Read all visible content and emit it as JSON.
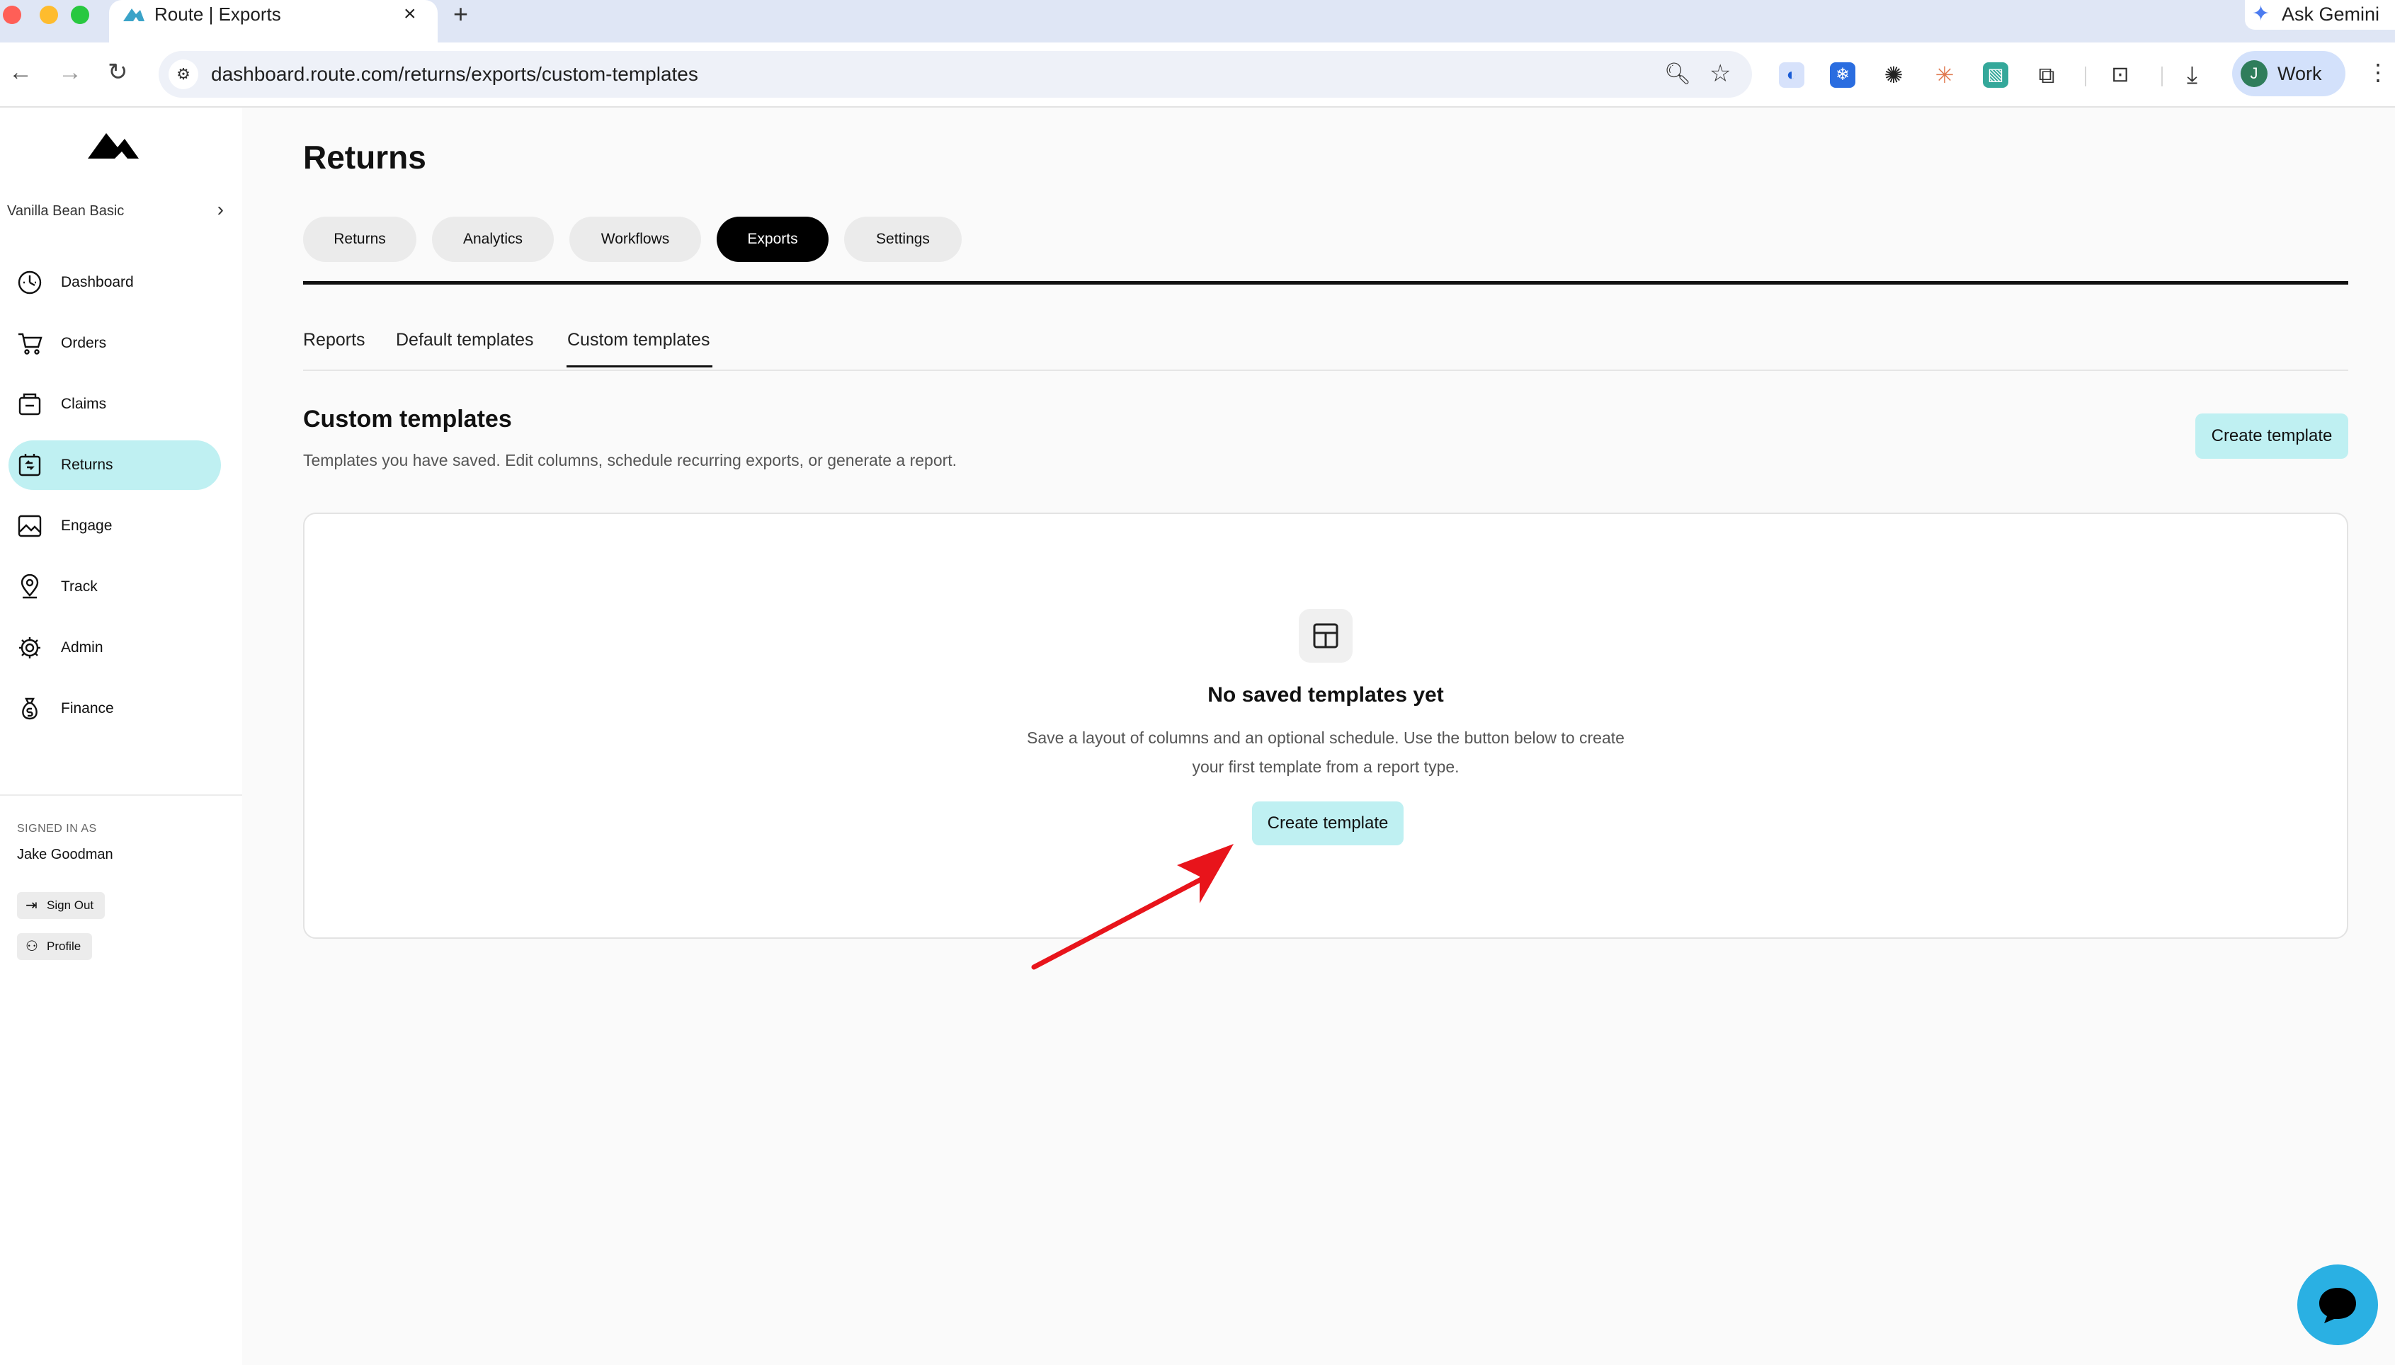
{
  "browser": {
    "tab_title": "Route | Exports",
    "tab_close": "×",
    "new_tab": "+",
    "gemini_label": "Ask Gemini",
    "url": "dashboard.route.com/returns/exports/custom-templates",
    "profile_initial": "J",
    "profile_name": "Work",
    "icons": {
      "back": "←",
      "forward": "→",
      "reload": "↻",
      "site_info": "⚙",
      "zoom": "🔍︎",
      "bookmark": "☆",
      "download": "⤓",
      "menu": "⋮"
    }
  },
  "sidebar": {
    "store_name": "Vanilla Bean Basic",
    "store_chevron": "›",
    "items": [
      {
        "label": "Dashboard",
        "icon": "dashboard-icon"
      },
      {
        "label": "Orders",
        "icon": "cart-icon"
      },
      {
        "label": "Claims",
        "icon": "claims-icon"
      },
      {
        "label": "Returns",
        "icon": "returns-icon",
        "active": true
      },
      {
        "label": "Engage",
        "icon": "image-icon"
      },
      {
        "label": "Track",
        "icon": "location-pin-icon"
      },
      {
        "label": "Admin",
        "icon": "gear-icon"
      },
      {
        "label": "Finance",
        "icon": "money-bag-icon"
      }
    ],
    "signed_in_caption": "SIGNED IN AS",
    "signed_in_name": "Jake Goodman",
    "sign_out_label": "Sign Out",
    "profile_label": "Profile"
  },
  "main": {
    "page_title": "Returns",
    "tabs": [
      {
        "label": "Returns",
        "active": false
      },
      {
        "label": "Analytics",
        "active": false
      },
      {
        "label": "Workflows",
        "active": false
      },
      {
        "label": "Exports",
        "active": true
      },
      {
        "label": "Settings",
        "active": false
      }
    ],
    "subtabs": [
      {
        "label": "Reports",
        "active": false
      },
      {
        "label": "Default templates",
        "active": false
      },
      {
        "label": "Custom templates",
        "active": true
      }
    ],
    "section_title": "Custom templates",
    "section_subtitle": "Templates you have saved. Edit columns, schedule recurring exports, or generate a report.",
    "create_button_label": "Create template",
    "empty_state": {
      "icon": "layout-template-icon",
      "title": "No saved templates yet",
      "text": "Save a layout of columns and an optional schedule. Use the button below to create your first template from a report type.",
      "button_label": "Create template"
    }
  },
  "colors": {
    "accent": "#bff0f2",
    "active_tab": "#000000",
    "chat_fab": "#2ab0e3",
    "annotation_arrow": "#e8141b"
  }
}
